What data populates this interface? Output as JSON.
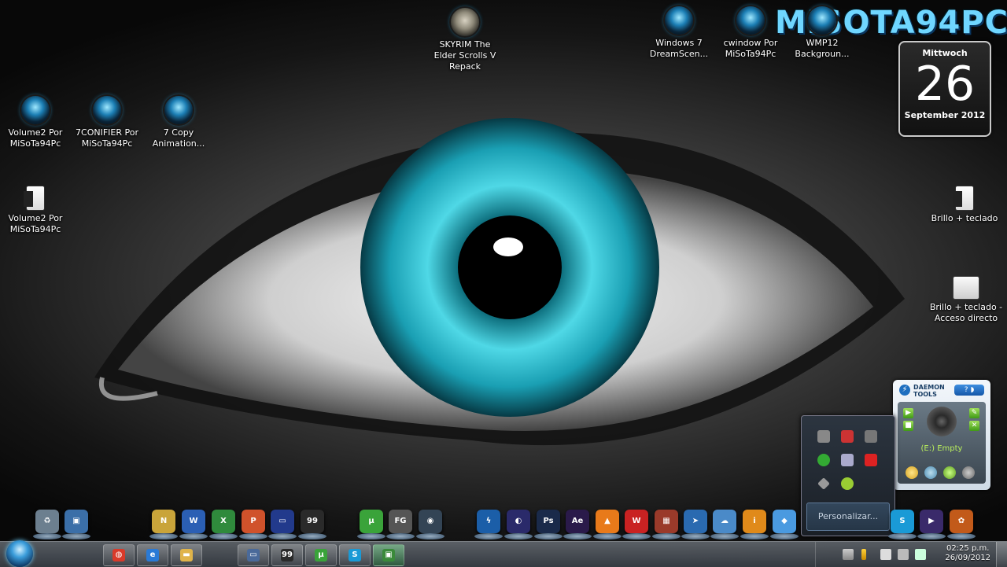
{
  "brand_text": "MISOTA94PC",
  "desktop_icons": [
    {
      "label": "SKYRIM The Elder Scrolls V Repack",
      "icon": "skyrim-icon"
    },
    {
      "label": "Windows 7 DreamScen...",
      "icon": "orb-icon"
    },
    {
      "label": "cwindow Por MiSoTa94Pc",
      "icon": "orb-icon"
    },
    {
      "label": "WMP12 Backgroun...",
      "icon": "orb-icon"
    },
    {
      "label": "Volume2 Por MiSoTa94Pc",
      "icon": "orb-icon"
    },
    {
      "label": "7CONIFIER Por MiSoTa94Pc",
      "icon": "orb-icon"
    },
    {
      "label": "7 Copy Animation...",
      "icon": "orb-icon"
    },
    {
      "label": "Volume2 Por MiSoTa94Pc",
      "icon": "document-icon"
    },
    {
      "label": "Brillo + teclado",
      "icon": "document-icon"
    },
    {
      "label": "Brillo + teclado - Acceso directo",
      "icon": "shortcut-icon"
    }
  ],
  "calendar": {
    "weekday": "Mittwoch",
    "day": "26",
    "month_year": "September 2012"
  },
  "daemon_tools": {
    "title_line1": "DAEMON",
    "title_line2": "TOOLS",
    "help": "?",
    "drive_status": "(E:) Empty"
  },
  "tray_flyout": {
    "customize_label": "Personalizar..."
  },
  "dock_items": [
    {
      "icon": "recycle-bin-icon",
      "glyph": "♻",
      "color": "#6c7f8f"
    },
    {
      "icon": "computer-icon",
      "glyph": "▣",
      "color": "#3b6fa8"
    },
    {
      "icon": "notepad-icon",
      "glyph": "N",
      "color": "#c9a43a"
    },
    {
      "icon": "word-icon",
      "glyph": "W",
      "color": "#2b5fb4"
    },
    {
      "icon": "excel-icon",
      "glyph": "X",
      "color": "#2f8a3c"
    },
    {
      "icon": "powerpoint-icon",
      "glyph": "P",
      "color": "#d0522b"
    },
    {
      "icon": "monitor-icon",
      "glyph": "▭",
      "color": "#223a8c"
    },
    {
      "icon": "game-icon",
      "glyph": "99",
      "color": "#2a2a2a"
    },
    {
      "icon": "utorrent-icon",
      "glyph": "µ",
      "color": "#3aa33a"
    },
    {
      "icon": "fullglass-icon",
      "glyph": "FG",
      "color": "#555"
    },
    {
      "icon": "globe-icon",
      "glyph": "◉",
      "color": "#345"
    },
    {
      "icon": "bolt-icon",
      "glyph": "ϟ",
      "color": "#1b5ea8"
    },
    {
      "icon": "eclipse-icon",
      "glyph": "◐",
      "color": "#2a2a6a"
    },
    {
      "icon": "photoshop-icon",
      "glyph": "Ps",
      "color": "#1a2a4a"
    },
    {
      "icon": "aftereffects-icon",
      "glyph": "Ae",
      "color": "#2a1a4a"
    },
    {
      "icon": "vlc-icon",
      "glyph": "▲",
      "color": "#e87a1a"
    },
    {
      "icon": "sw-icon",
      "glyph": "W",
      "color": "#c92222"
    },
    {
      "icon": "package-icon",
      "glyph": "▦",
      "color": "#9a3a2a"
    },
    {
      "icon": "cursor-icon",
      "glyph": "➤",
      "color": "#2a6ab0"
    },
    {
      "icon": "weather-icon",
      "glyph": "☁",
      "color": "#4a8ac8"
    },
    {
      "icon": "info-icon",
      "glyph": "i",
      "color": "#e08a1a"
    },
    {
      "icon": "crystal-icon",
      "glyph": "◆",
      "color": "#4a9ae0"
    },
    {
      "icon": "skype-icon",
      "glyph": "S",
      "color": "#1a9ad6"
    },
    {
      "icon": "media-player-icon",
      "glyph": "▶",
      "color": "#3a2a6a"
    },
    {
      "icon": "pet-icon",
      "glyph": "✿",
      "color": "#c25a1a"
    }
  ],
  "taskbar_buttons": [
    {
      "icon": "chrome-icon",
      "glyph": "◍",
      "color": "#d93a2a"
    },
    {
      "icon": "ie-icon",
      "glyph": "e",
      "color": "#2a7ad6"
    },
    {
      "icon": "folder-icon",
      "glyph": "▬",
      "color": "#e0b44a"
    },
    {
      "icon": "window-icon",
      "glyph": "▭",
      "color": "#4a6a9a"
    },
    {
      "icon": "game-icon",
      "glyph": "99",
      "color": "#2a2a2a"
    },
    {
      "icon": "utorrent-icon",
      "glyph": "µ",
      "color": "#3aa33a"
    },
    {
      "icon": "skype-icon",
      "glyph": "S",
      "color": "#1a9ad6"
    },
    {
      "icon": "camtasia-icon",
      "glyph": "▣",
      "color": "#3a8a3a"
    }
  ],
  "clock": {
    "time": "02:25 p.m.",
    "date": "26/09/2012"
  }
}
